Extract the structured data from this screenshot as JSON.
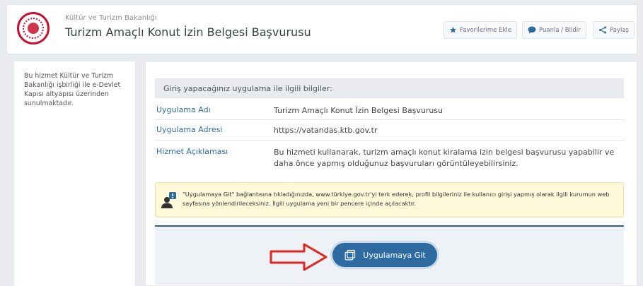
{
  "header": {
    "ministry": "Kültür ve Turizm Bakanlığı",
    "title": "Turizm Amaçlı Konut İzin Belgesi Başvurusu",
    "buttons": {
      "favorite": "Favorilerime Ekle",
      "rate": "Puanla / Bildir",
      "share": "Paylaş"
    }
  },
  "sidebar": {
    "text": "Bu hizmet Kültür ve Turizm Bakanlığı işbirliği ile e-Devlet Kapısı altyapısı üzerinden sunulmaktadır."
  },
  "main": {
    "info_heading": "Giriş yapacağınız uygulama ile ilgili bilgiler:",
    "rows": [
      {
        "label": "Uygulama Adı",
        "value": "Turizm Amaçlı Konut İzin Belgesi Başvurusu"
      },
      {
        "label": "Uygulama Adresi",
        "value": "https://vatandas.ktb.gov.tr"
      },
      {
        "label": "Hizmet Açıklaması",
        "value": "Bu hizmeti kullanarak, turizm amaçlı konut kiralama izin belgesi başvurusu yapabilir ve daha önce yapmış olduğunuz başvuruları görüntüleyebilirsiniz."
      }
    ],
    "notice": "\"Uygulamaya Git\" bağlantısına tıkladığınızda, www.türkiye.gov.tr'yi terk ederek, profil bilgileriniz ile kullanıcı girişi yapmış olarak ilgili kurumun web sayfasına yönlendirileceksiniz. İlgili uygulama yeni bir pencere içinde açılacaktır.",
    "go_button": "Uygulamaya Git"
  },
  "colors": {
    "accent": "#2c6aa0",
    "label_blue": "#2f6fa6",
    "arrow_red": "#e0251f",
    "notice_bg": "#fff8d9"
  },
  "icons": [
    "ministry-logo",
    "star-icon",
    "speech-bubble-icon",
    "share-icon",
    "user-info-icon",
    "red-arrow-icon",
    "external-window-icon"
  ]
}
